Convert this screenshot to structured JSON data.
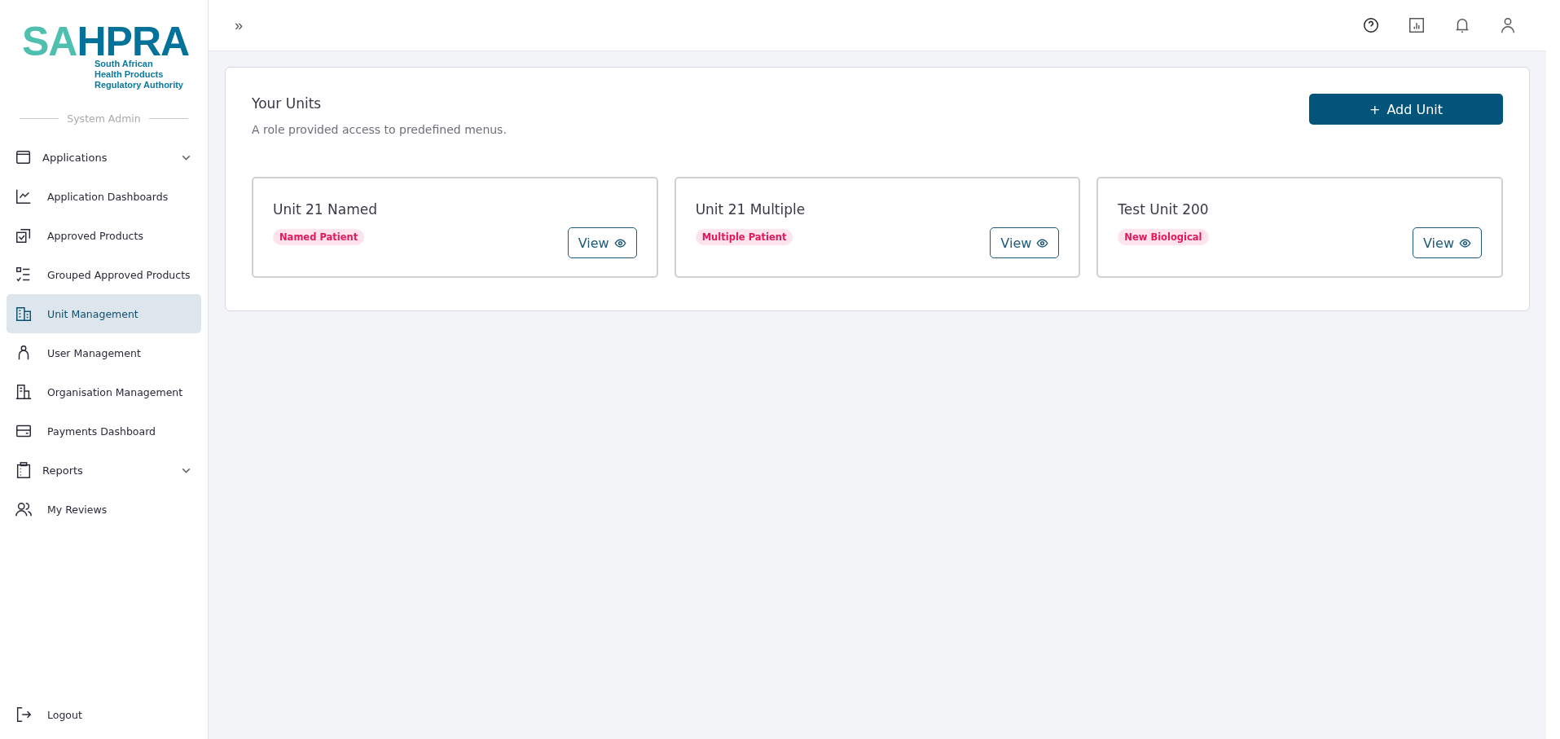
{
  "logo": {
    "wordmark_left": "SA",
    "wordmark_right": "HPRA",
    "tagline": [
      "South African",
      "Health Products",
      "Regulatory Authority"
    ]
  },
  "sidebar": {
    "role_label": "System Admin",
    "items": [
      {
        "label": "Applications",
        "kind": "group",
        "expanded": false,
        "selected": false
      },
      {
        "label": "Application Dashboards",
        "kind": "link",
        "selected": false
      },
      {
        "label": "Approved Products",
        "kind": "link",
        "selected": false
      },
      {
        "label": "Grouped Approved Products",
        "kind": "link",
        "selected": false
      },
      {
        "label": "Unit Management",
        "kind": "link",
        "selected": true
      },
      {
        "label": "User Management",
        "kind": "link",
        "selected": false
      },
      {
        "label": "Organisation Management",
        "kind": "link",
        "selected": false
      },
      {
        "label": "Payments Dashboard",
        "kind": "link",
        "selected": false
      },
      {
        "label": "Reports",
        "kind": "group",
        "expanded": false,
        "selected": false
      },
      {
        "label": "My Reviews",
        "kind": "link",
        "selected": false
      }
    ],
    "logout": "Logout"
  },
  "header": {
    "collapse_toggle": "»"
  },
  "page": {
    "title": "Your Units",
    "subtitle": "A role provided access to predefined menus.",
    "add_button": {
      "icon": "+",
      "label": "Add Unit"
    }
  },
  "units": [
    {
      "name": "Unit 21 Named",
      "tag": "Named Patient",
      "button": "View"
    },
    {
      "name": "Unit 21 Multiple",
      "tag": "Multiple Patient",
      "button": "View"
    },
    {
      "name": "Test Unit 200",
      "tag": "New Biological",
      "button": "View"
    }
  ]
}
